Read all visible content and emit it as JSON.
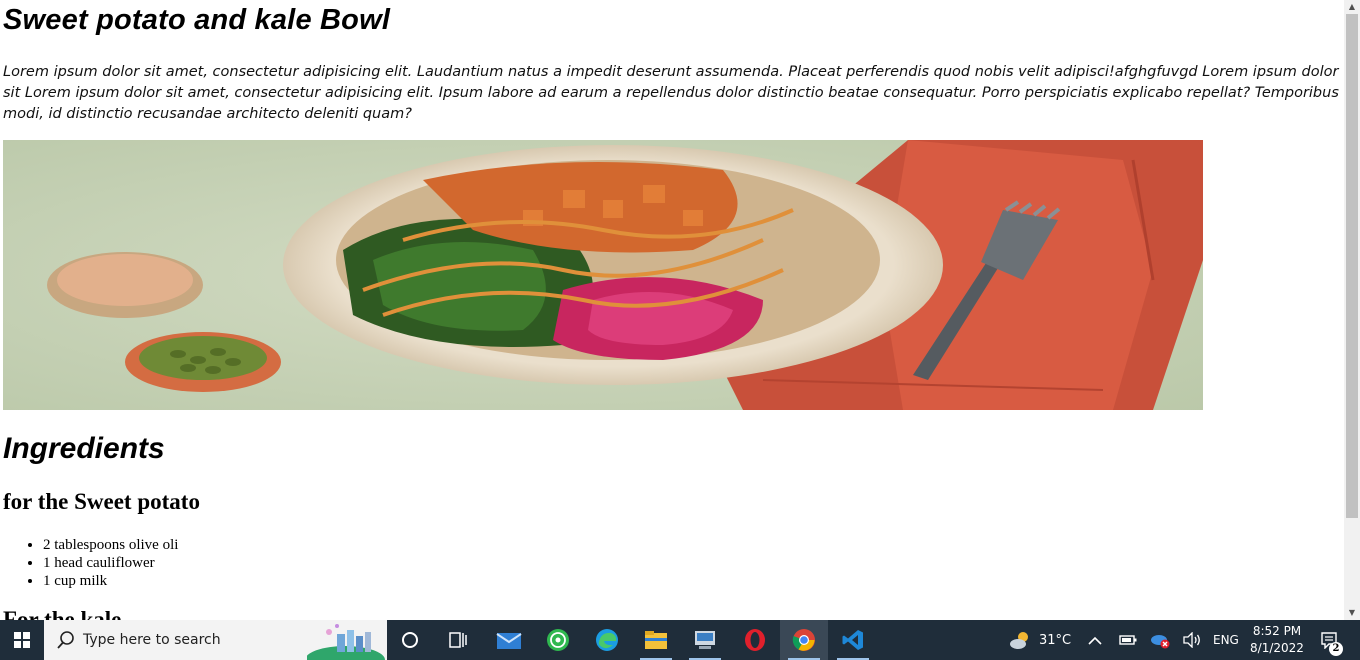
{
  "page": {
    "title": "Sweet potato and kale Bowl",
    "intro": "Lorem ipsum dolor sit amet, consectetur adipisicing elit. Laudantium natus a impedit deserunt assumenda. Placeat perferendis quod nobis velit adipisci!afghgfuvgd Lorem ipsum dolor sit Lorem ipsum dolor sit amet, consectetur adipisicing elit. Ipsum labore ad earum a repellendus dolor distinctio beatae consequatur. Porro perspiciatis explicabo repellat? Temporibus modi, id distinctio recusandae architecto deleniti quam?",
    "image_subject": "bowl-with-sweet-potato-kale-cabbage-sauce-fork-napkin",
    "ingredients_heading": "Ingredients",
    "sweet_potato_heading": "for the Sweet potato",
    "sweet_potato_items": [
      "2 tablespoons olive oli",
      "1 head cauliflower",
      "1 cup milk"
    ],
    "kale_heading": "For the kale"
  },
  "taskbar": {
    "search_placeholder": "Type here to search",
    "apps": [
      "cortana-icon",
      "task-view-icon",
      "mail-icon",
      "whatsapp-icon",
      "edge-icon",
      "file-explorer-icon",
      "system-app-icon",
      "opera-icon",
      "chrome-icon",
      "vscode-icon"
    ],
    "weather": "31°C",
    "language": "ENG",
    "time": "8:52 PM",
    "date": "8/1/2022",
    "notification_count": "2",
    "colors": {
      "taskbar": "#1f2d3a",
      "search_box": "#f3f3f3",
      "active_indicator": "#9ec4ea"
    }
  }
}
